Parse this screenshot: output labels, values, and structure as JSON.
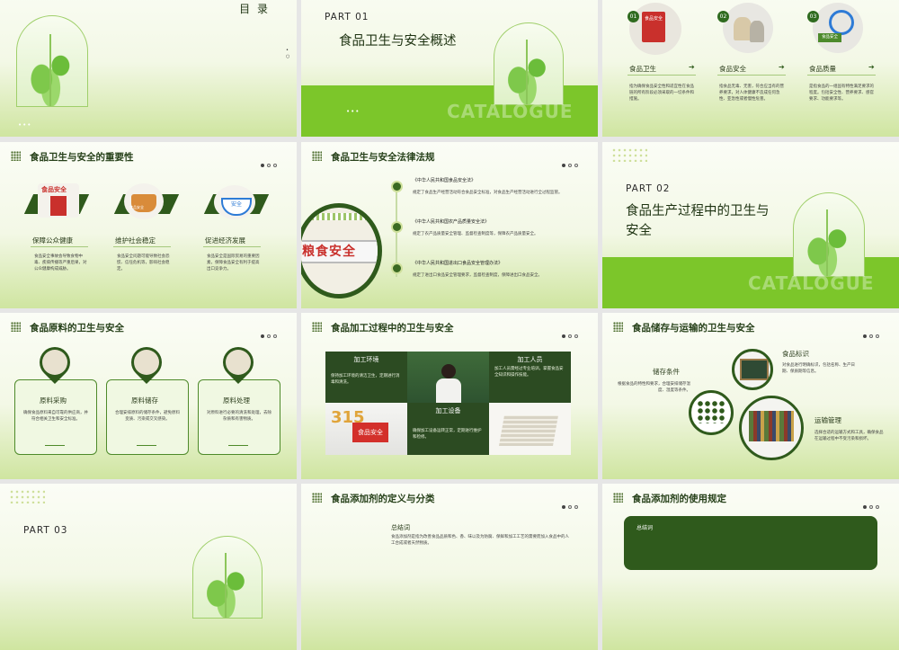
{
  "s1": {
    "title": "目 录"
  },
  "s2": {
    "part": "PART   01",
    "heading": "食品卫生与安全概述",
    "watermark": "CATALOGUE"
  },
  "s3": {
    "items": [
      {
        "num": "01",
        "label": "食品卫生",
        "desc": "指为确保食品安全性和适宜性在食品链的所有阶段必须采取的一切条件和措施。",
        "sign": "食品安全"
      },
      {
        "num": "02",
        "label": "食品安全",
        "desc": "指食品无毒、无害，符合应当有的营养要求，对人体健康不造成任何急性、亚急性或者慢性危害。"
      },
      {
        "num": "03",
        "label": "食品质量",
        "desc": "是指食品的一组固有特性满足要求的程度。包括安全性、营养要求、感官要求、功能要求等。",
        "sign": "食品安全"
      }
    ]
  },
  "s4": {
    "title": "食品卫生与安全的重要性",
    "items": [
      {
        "label": "保障公众健康",
        "desc": "食品安全事故会导致食物中毒、疾病传播等严重后果，对公众健康构成威胁。",
        "sign": "食品安全"
      },
      {
        "label": "维护社会稳定",
        "desc": "食品安全问题可能导致社会恐慌、信任危机等，影响社会稳定。",
        "sign": "食品安全"
      },
      {
        "label": "促进经济发展",
        "desc": "食品安全是国际贸易的重要因素，保障食品安全有利于提高出口竞争力。",
        "sign": "安全"
      }
    ]
  },
  "s5": {
    "title": "食品卫生与安全法律法规",
    "sign": "粮食安全",
    "items": [
      {
        "name": "《中华人民共和国食品安全法》",
        "desc": "规定了食品生产经营活动符合食品安全标准，对食品生产经营活动进行全过程监管。"
      },
      {
        "name": "《中华人民共和国农产品质量安全法》",
        "desc": "规定了农产品质量安全管理、监督检查制度等，保障农产品质量安全。"
      },
      {
        "name": "《中华人民共和国进出口食品安全管理办法》",
        "desc": "规定了进出口食品安全管理要求，监督检查制度，保障进出口食品安全。"
      }
    ]
  },
  "s6": {
    "part": "PART   02",
    "heading1": "食品生产过程中的卫生与",
    "heading2": "安全",
    "watermark": "CATALOGUE"
  },
  "s7": {
    "title": "食品原料的卫生与安全",
    "items": [
      {
        "label": "原料采购",
        "desc": "确保食品原料来自可靠的供应商，并符合相关卫生和安全标准。"
      },
      {
        "label": "原料储存",
        "desc": "合理安排原料的储存条件，避免原料变质、污染或交叉感染。"
      },
      {
        "label": "原料处理",
        "desc": "对原料进行必要的清洗和处理，去除杂质和有害物质。"
      }
    ]
  },
  "s8": {
    "title": "食品加工过程中的卫生与安全",
    "tiles": [
      {
        "label": "加工环境",
        "desc": "保持加工环境的清洁卫生，定期进行消毒和清洗。"
      },
      {
        "label": "加工人员",
        "desc": "加工人员需经过专业培训，掌握食品安全知识和操作技能。"
      },
      {
        "label": "加工设备",
        "desc": "确保加工设备运转正常，定期进行维护和检修。"
      }
    ],
    "photo_sign": "食品安全",
    "photo_num": "315"
  },
  "s9": {
    "title": "食品储存与运输的卫生与安全",
    "items": [
      {
        "label": "食品标识",
        "desc": "对食品进行明确标识，包括名称、生产日期、保质期等信息。"
      },
      {
        "label": "储存条件",
        "desc": "根据食品的特性和要求，合理安排储存温度、湿度等条件。"
      },
      {
        "label": "运输管理",
        "desc": "选择合适的运输方式和工具，确保食品在运输过程中不受污染和损坏。"
      }
    ]
  },
  "s10": {
    "part": "PART   03"
  },
  "s11": {
    "title": "食品添加剂的定义与分类",
    "sub": "总结词",
    "desc": "食品添加剂是指为改善食品品质和色、香、味以及为防腐、保鲜和加工工艺的需要而加入食品中的人工合成或者天然物质。"
  },
  "s12": {
    "title": "食品添加剂的使用规定",
    "sub": "总结词"
  }
}
